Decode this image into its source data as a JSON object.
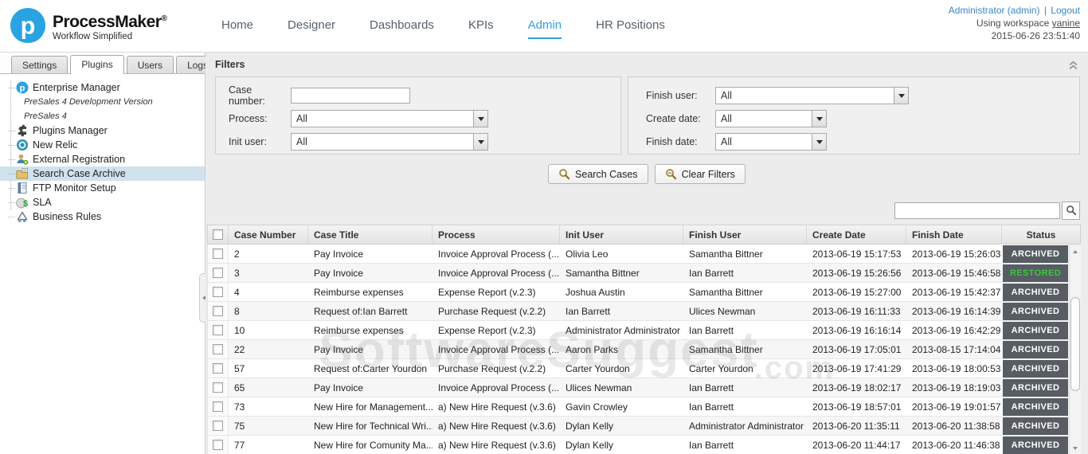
{
  "header": {
    "brand": "ProcessMaker",
    "brand_mark": "®",
    "tagline": "Workflow Simplified",
    "nav": [
      {
        "label": "Home",
        "active": false
      },
      {
        "label": "Designer",
        "active": false
      },
      {
        "label": "Dashboards",
        "active": false
      },
      {
        "label": "KPIs",
        "active": false
      },
      {
        "label": "Admin",
        "active": true
      },
      {
        "label": "HR Positions",
        "active": false
      }
    ],
    "account": {
      "user_link": "Administrator (admin)",
      "separator": "|",
      "logout_link": "Logout",
      "workspace_prefix": "Using workspace",
      "workspace_name": "yanine",
      "datetime": "2015-06-26 23:51:40"
    }
  },
  "sidebar": {
    "tabs": [
      {
        "label": "Settings",
        "active": false
      },
      {
        "label": "Plugins",
        "active": true
      },
      {
        "label": "Users",
        "active": false
      },
      {
        "label": "Logs",
        "active": false
      }
    ],
    "tree": [
      {
        "label": "Enterprise Manager",
        "icon": "pm-logo-icon",
        "style": "normal",
        "selected": false
      },
      {
        "label": "PreSales 4 Development Version",
        "style": "italic",
        "selected": false
      },
      {
        "label": "PreSales 4",
        "style": "italic",
        "selected": false
      },
      {
        "label": "Plugins Manager",
        "icon": "puzzle-icon",
        "style": "normal",
        "selected": false
      },
      {
        "label": "New Relic",
        "icon": "newrelic-icon",
        "style": "normal",
        "selected": false
      },
      {
        "label": "External Registration",
        "icon": "user-add-icon",
        "style": "normal",
        "selected": false
      },
      {
        "label": "Search Case Archive",
        "icon": "archive-folder-icon",
        "style": "normal",
        "selected": true
      },
      {
        "label": "FTP Monitor Setup",
        "icon": "notebook-icon",
        "style": "normal",
        "selected": false
      },
      {
        "label": "SLA",
        "icon": "dollar-icon",
        "style": "normal",
        "selected": false
      },
      {
        "label": "Business Rules",
        "icon": "rules-icon",
        "style": "normal",
        "selected": false
      }
    ]
  },
  "filters": {
    "title": "Filters",
    "left": [
      {
        "label": "Case number:",
        "type": "text",
        "value": ""
      },
      {
        "label": "Process:",
        "type": "select",
        "value": "All"
      },
      {
        "label": "Init user:",
        "type": "select",
        "value": "All"
      }
    ],
    "right": [
      {
        "label": "Finish user:",
        "type": "select",
        "value": "All"
      },
      {
        "label": "Create date:",
        "type": "select",
        "value": "All"
      },
      {
        "label": "Finish date:",
        "type": "select",
        "value": "All"
      }
    ],
    "buttons": {
      "search": "Search Cases",
      "clear": "Clear Filters"
    }
  },
  "toolbar_search": {
    "value": ""
  },
  "table": {
    "columns": [
      "Case Number",
      "Case Title",
      "Process",
      "Init User",
      "Finish User",
      "Create Date",
      "Finish Date",
      "Status"
    ],
    "rows": [
      {
        "case_number": "2",
        "case_title": "Pay Invoice",
        "process": "Invoice Approval Process (...",
        "init_user": "Olivia Leo",
        "finish_user": "Samantha Bittner",
        "create_date": "2013-06-19 15:17:53",
        "finish_date": "2013-06-19 15:26:03",
        "status": "ARCHIVED"
      },
      {
        "case_number": "3",
        "case_title": "Pay Invoice",
        "process": "Invoice Approval Process (...",
        "init_user": "Samantha Bittner",
        "finish_user": "Ian Barrett",
        "create_date": "2013-06-19 15:26:56",
        "finish_date": "2013-06-19 15:46:58",
        "status": "RESTORED"
      },
      {
        "case_number": "4",
        "case_title": "Reimburse expenses",
        "process": "Expense Report (v.2.3)",
        "init_user": "Joshua Austin",
        "finish_user": "Samantha Bittner",
        "create_date": "2013-06-19 15:27:00",
        "finish_date": "2013-06-19 15:42:37",
        "status": "ARCHIVED"
      },
      {
        "case_number": "8",
        "case_title": "Request of:Ian Barrett",
        "process": "Purchase Request (v.2.2)",
        "init_user": "Ian Barrett",
        "finish_user": "Ulices Newman",
        "create_date": "2013-06-19 16:11:33",
        "finish_date": "2013-06-19 16:14:39",
        "status": "ARCHIVED"
      },
      {
        "case_number": "10",
        "case_title": "Reimburse expenses",
        "process": "Expense Report (v.2.3)",
        "init_user": "Administrator Administrator",
        "finish_user": "Ian Barrett",
        "create_date": "2013-06-19 16:16:14",
        "finish_date": "2013-06-19 16:42:29",
        "status": "ARCHIVED"
      },
      {
        "case_number": "22",
        "case_title": "Pay Invoice",
        "process": "Invoice Approval Process (...",
        "init_user": "Aaron Parks",
        "finish_user": "Samantha Bittner",
        "create_date": "2013-06-19 17:05:01",
        "finish_date": "2013-08-15 17:14:04",
        "status": "ARCHIVED"
      },
      {
        "case_number": "57",
        "case_title": "Request of:Carter Yourdon",
        "process": "Purchase Request (v.2.2)",
        "init_user": "Carter Yourdon",
        "finish_user": "Carter Yourdon",
        "create_date": "2013-06-19 17:41:29",
        "finish_date": "2013-06-19 18:00:53",
        "status": "ARCHIVED"
      },
      {
        "case_number": "65",
        "case_title": "Pay Invoice",
        "process": "Invoice Approval Process (...",
        "init_user": "Ulices Newman",
        "finish_user": "Ian Barrett",
        "create_date": "2013-06-19 18:02:17",
        "finish_date": "2013-06-19 18:19:03",
        "status": "ARCHIVED"
      },
      {
        "case_number": "73",
        "case_title": "New Hire for Management...",
        "process": "a) New Hire Request (v.3.6)",
        "init_user": "Gavin Crowley",
        "finish_user": "Ian Barrett",
        "create_date": "2013-06-19 18:57:01",
        "finish_date": "2013-06-19 19:01:57",
        "status": "ARCHIVED"
      },
      {
        "case_number": "75",
        "case_title": "New Hire for Technical Wri...",
        "process": "a) New Hire Request (v.3.6)",
        "init_user": "Dylan Kelly",
        "finish_user": "Administrator Administrator",
        "create_date": "2013-06-20 11:35:11",
        "finish_date": "2013-06-20 11:38:58",
        "status": "ARCHIVED"
      },
      {
        "case_number": "77",
        "case_title": "New Hire for Comunity Ma...",
        "process": "a) New Hire Request (v.3.6)",
        "init_user": "Dylan Kelly",
        "finish_user": "Ian Barrett",
        "create_date": "2013-06-20 11:44:17",
        "finish_date": "2013-06-20 11:46:38",
        "status": "ARCHIVED"
      }
    ]
  },
  "watermark": {
    "text": "SoftwareSuggest",
    "suffix": ".com"
  },
  "colors": {
    "accent": "#35a0dc",
    "link": "#3a87c8",
    "status_archived_bg": "#575d63",
    "status_restored_text": "#33cc33",
    "selected_tree_bg": "#cfe2ee"
  }
}
